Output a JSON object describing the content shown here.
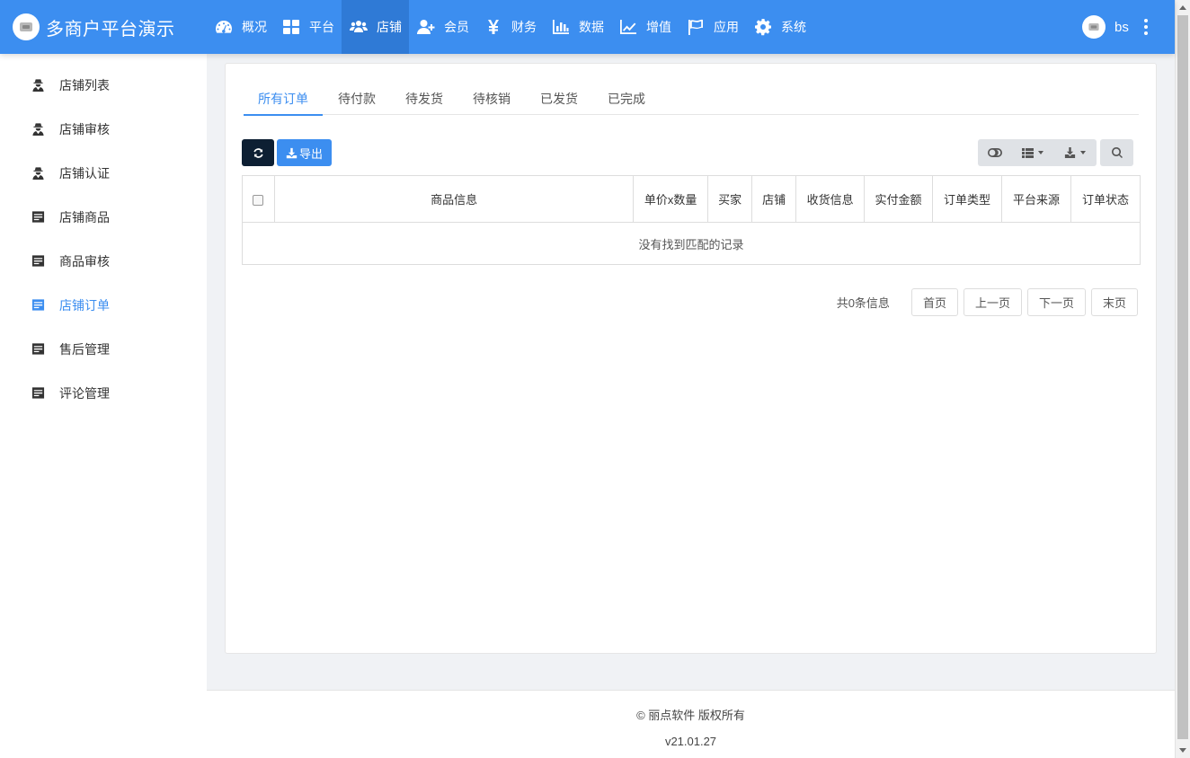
{
  "app": {
    "title": "多商户平台演示"
  },
  "nav": [
    {
      "label": "概况",
      "icon": "dashboard-icon"
    },
    {
      "label": "平台",
      "icon": "grid-icon"
    },
    {
      "label": "店铺",
      "icon": "users-icon",
      "active": true
    },
    {
      "label": "会员",
      "icon": "user-plus-icon"
    },
    {
      "label": "财务",
      "icon": "yen-icon"
    },
    {
      "label": "数据",
      "icon": "bar-chart-icon"
    },
    {
      "label": "增值",
      "icon": "line-chart-icon"
    },
    {
      "label": "应用",
      "icon": "flag-icon"
    },
    {
      "label": "系统",
      "icon": "gear-icon"
    }
  ],
  "user": {
    "name": "bs"
  },
  "sidebar": [
    {
      "label": "店铺列表",
      "icon": "user-secret-icon"
    },
    {
      "label": "店铺审核",
      "icon": "user-secret-icon"
    },
    {
      "label": "店铺认证",
      "icon": "user-secret-icon"
    },
    {
      "label": "店铺商品",
      "icon": "list-alt-icon"
    },
    {
      "label": "商品审核",
      "icon": "list-alt-icon"
    },
    {
      "label": "店铺订单",
      "icon": "list-alt-icon",
      "active": true
    },
    {
      "label": "售后管理",
      "icon": "list-alt-icon"
    },
    {
      "label": "评论管理",
      "icon": "list-alt-icon"
    }
  ],
  "tabs": [
    "所有订单",
    "待付款",
    "待发货",
    "待核销",
    "已发货",
    "已完成"
  ],
  "toolbar": {
    "export_label": "导出"
  },
  "table": {
    "columns": [
      "商品信息",
      "单价x数量",
      "买家",
      "店铺",
      "收货信息",
      "实付金额",
      "订单类型",
      "平台来源",
      "订单状态"
    ],
    "empty_text": "没有找到匹配的记录"
  },
  "pager": {
    "info": "共0条信息",
    "first": "首页",
    "prev": "上一页",
    "next": "下一页",
    "last": "末页"
  },
  "footer": {
    "copyright": "© 丽点软件 版权所有",
    "version": "v21.01.27"
  },
  "colors": {
    "primary": "#3c8ef0",
    "dark_button": "#0d1f33"
  }
}
